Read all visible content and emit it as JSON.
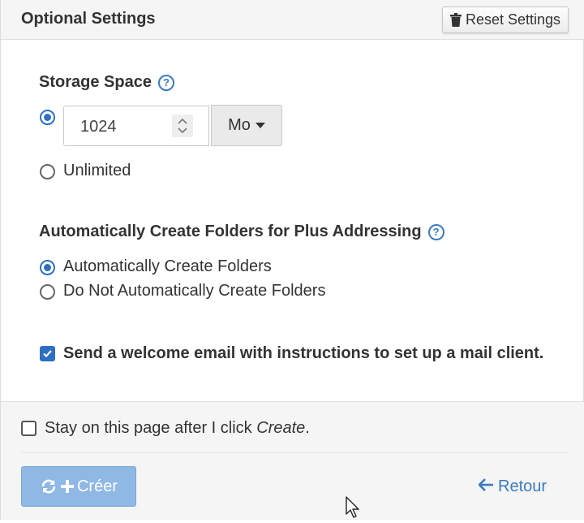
{
  "header": {
    "title": "Optional Settings",
    "reset_label": "Reset Settings",
    "reset_icon": "trash-icon"
  },
  "storage": {
    "label": "Storage Space",
    "help_icon": "help-circle-icon",
    "value": "1024",
    "unit": "Mo",
    "unlimited_label": "Unlimited",
    "selected": "custom"
  },
  "folders": {
    "label": "Automatically Create Folders for Plus Addressing",
    "help_icon": "help-circle-icon",
    "options": [
      {
        "label": "Automatically Create Folders",
        "checked": true
      },
      {
        "label": "Do Not Automatically Create Folders",
        "checked": false
      }
    ]
  },
  "welcome": {
    "label": "Send a welcome email with instructions to set up a mail client.",
    "checked": true
  },
  "footer": {
    "stay_prefix": "Stay on this page after I click ",
    "stay_emphasis": "Create",
    "stay_suffix": ".",
    "stay_checked": false,
    "create_label": "Créer",
    "back_label": "Retour"
  },
  "colors": {
    "accent": "#2d6fc1",
    "link": "#3b7bbf",
    "create_button": "#8fb8e4",
    "header_bg": "#f5f5f5"
  }
}
